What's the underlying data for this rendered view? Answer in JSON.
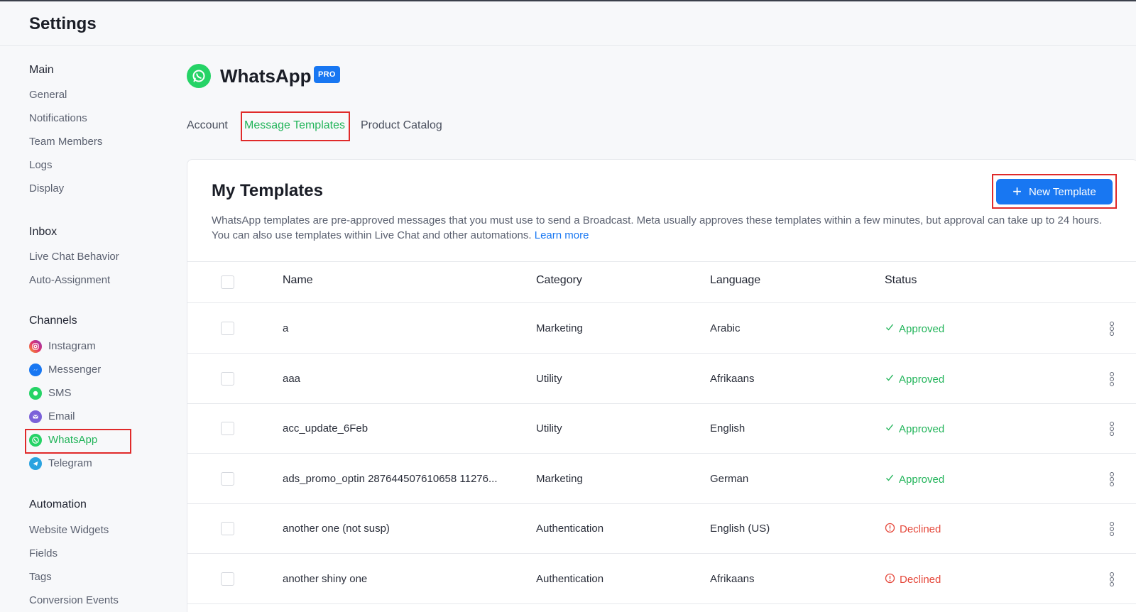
{
  "header": {
    "title": "Settings"
  },
  "sidebar": {
    "sections": [
      {
        "title": "Main",
        "items": [
          "General",
          "Notifications",
          "Team Members",
          "Logs",
          "Display"
        ]
      },
      {
        "title": "Inbox",
        "items": [
          "Live Chat Behavior",
          "Auto-Assignment"
        ]
      },
      {
        "title": "Channels",
        "items": [
          "Instagram",
          "Messenger",
          "SMS",
          "Email",
          "WhatsApp",
          "Telegram"
        ]
      },
      {
        "title": "Automation",
        "items": [
          "Website Widgets",
          "Fields",
          "Tags",
          "Conversion Events"
        ]
      }
    ]
  },
  "page": {
    "title": "WhatsApp",
    "badge": "PRO",
    "tabs": [
      "Account",
      "Message Templates",
      "Product Catalog"
    ]
  },
  "templates": {
    "title": "My Templates",
    "new_button": "New Template",
    "description": "WhatsApp templates are pre-approved messages that you must use to send a Broadcast. Meta usually approves these templates within a few minutes, but approval can take up to 24 hours. You can also use templates within Live Chat and other automations.",
    "learn_more": "Learn more",
    "columns": [
      "Name",
      "Category",
      "Language",
      "Status"
    ],
    "rows": [
      {
        "name": "a",
        "category": "Marketing",
        "language": "Arabic",
        "status": "Approved"
      },
      {
        "name": "aaa",
        "category": "Utility",
        "language": "Afrikaans",
        "status": "Approved"
      },
      {
        "name": "acc_update_6Feb",
        "category": "Utility",
        "language": "English",
        "status": "Approved"
      },
      {
        "name": "ads_promo_optin 287644507610658 11276...",
        "category": "Marketing",
        "language": "German",
        "status": "Approved"
      },
      {
        "name": "another one (not susp)",
        "category": "Authentication",
        "language": "English (US)",
        "status": "Declined"
      },
      {
        "name": "another shiny one",
        "category": "Authentication",
        "language": "Afrikaans",
        "status": "Declined"
      }
    ]
  },
  "colors": {
    "accent": "#1877f2",
    "approved": "#22b45a",
    "declined": "#e5483b",
    "whatsapp": "#25d366"
  }
}
